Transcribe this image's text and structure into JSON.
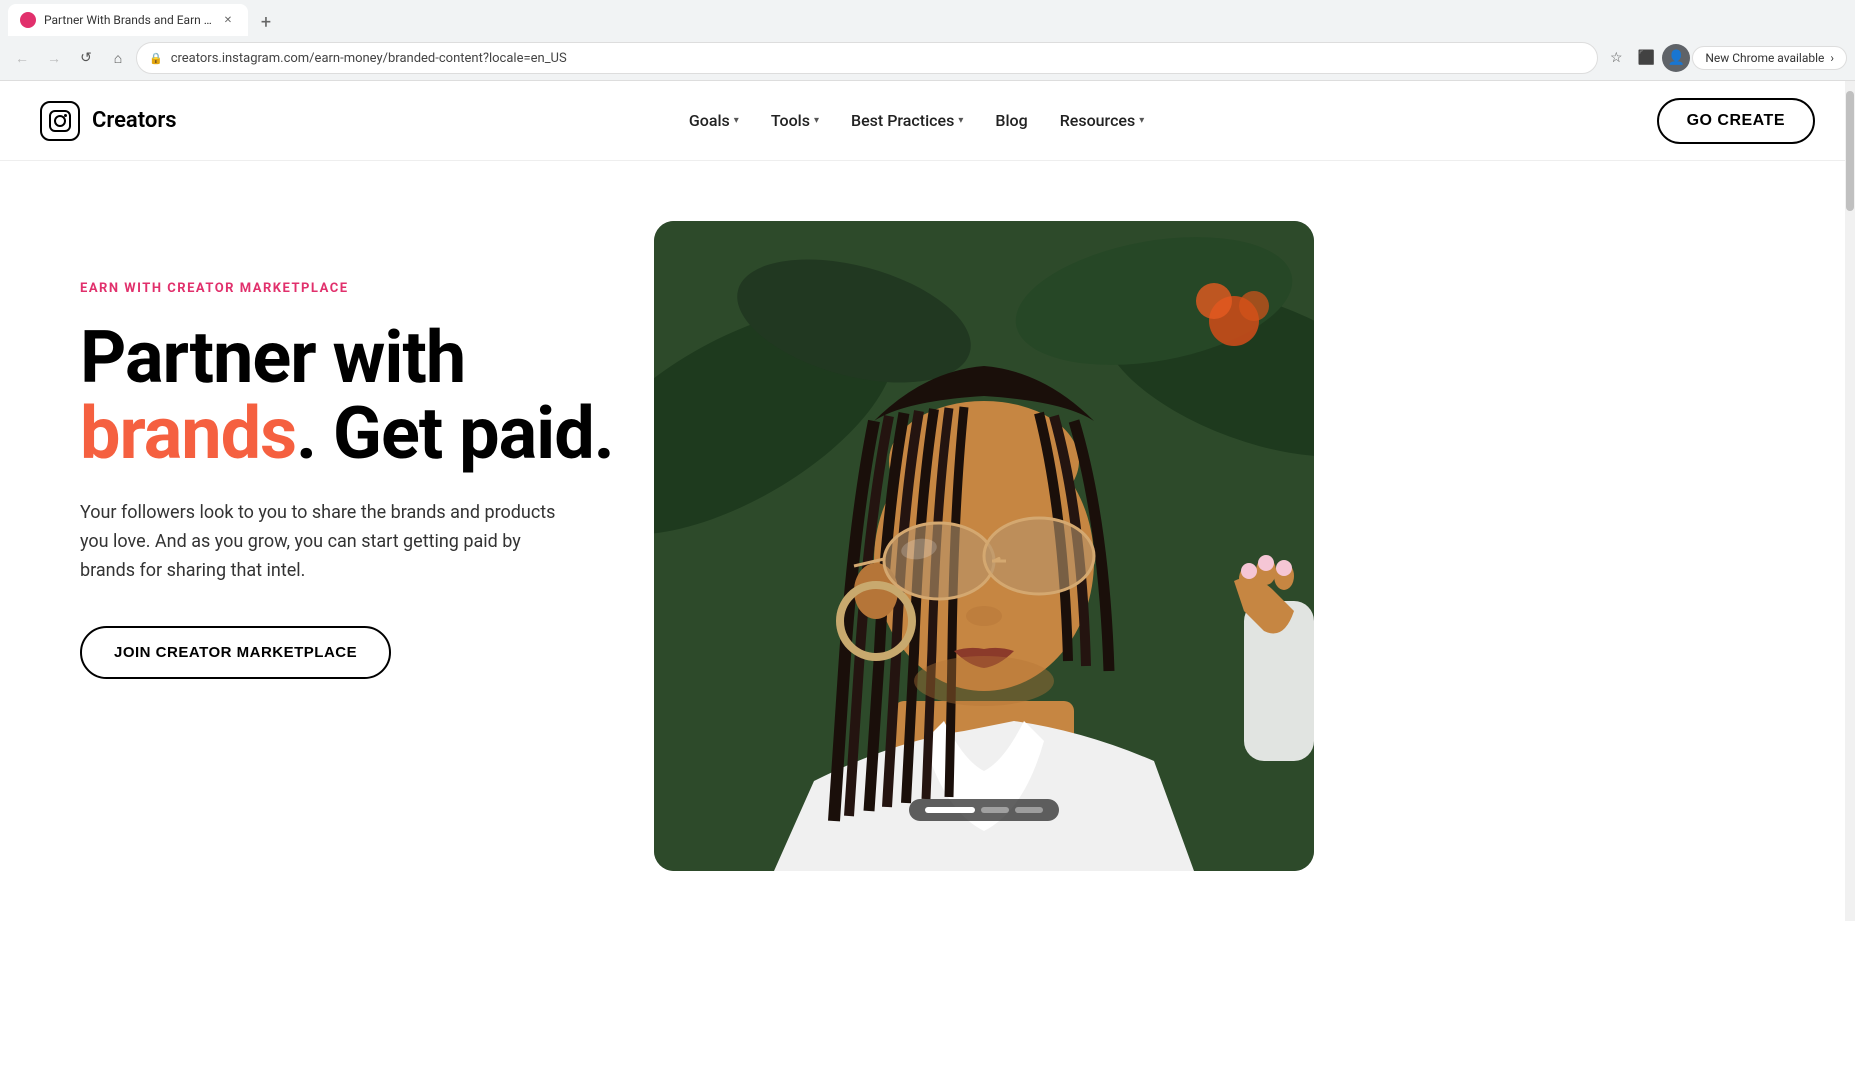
{
  "browser": {
    "tab": {
      "title": "Partner With Brands and Earn ...",
      "favicon_color": "#e1306c"
    },
    "address": "creators.instagram.com/earn-money/branded-content?locale=en_US",
    "new_chrome_label": "New Chrome available",
    "new_tab_btn": "+",
    "back_btn": "←",
    "forward_btn": "→",
    "refresh_btn": "↺",
    "home_btn": "⌂"
  },
  "nav": {
    "logo_text": "Creators",
    "links": [
      {
        "label": "Goals",
        "has_dropdown": true
      },
      {
        "label": "Tools",
        "has_dropdown": true
      },
      {
        "label": "Best Practices",
        "has_dropdown": true
      },
      {
        "label": "Blog",
        "has_dropdown": false
      },
      {
        "label": "Resources",
        "has_dropdown": true
      }
    ],
    "cta": "GO CREATE"
  },
  "hero": {
    "eyebrow": "EARN WITH CREATOR MARKETPLACE",
    "title_line1": "Partner with",
    "title_highlight": "brands",
    "title_line2": ". Get paid.",
    "description": "Your followers look to you to share the brands and products you love. And as you grow, you can start getting paid by brands for sharing that intel.",
    "cta_button": "JOIN CREATOR MARKETPLACE"
  },
  "colors": {
    "accent_pink": "#e1306c",
    "accent_orange": "#f56040",
    "black": "#000000",
    "white": "#ffffff"
  }
}
